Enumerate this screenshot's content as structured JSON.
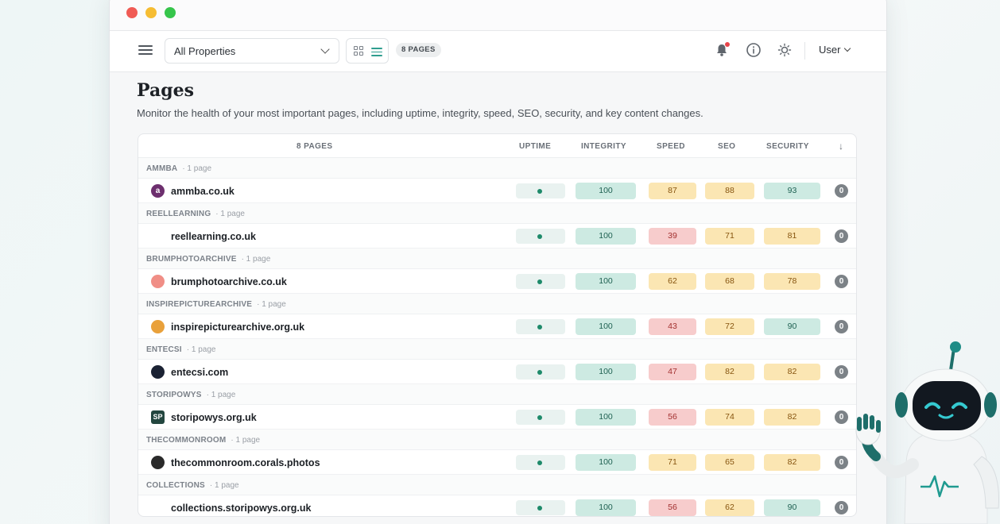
{
  "toolbar": {
    "property_select": "All Properties",
    "pages_badge": "8 PAGES",
    "user_label": "User"
  },
  "page": {
    "title": "Pages",
    "description": "Monitor the health of your most important pages, including uptime, integrity, speed, SEO, security, and key content changes."
  },
  "table": {
    "headers": {
      "pages": "8 PAGES",
      "uptime": "UPTIME",
      "integrity": "INTEGRITY",
      "speed": "SPEED",
      "seo": "SEO",
      "security": "SECURITY",
      "sort_arrow": "↓"
    },
    "groups": [
      {
        "name": "AMMBA",
        "count": "· 1 page",
        "site": "ammba.co.uk",
        "favicon_char": "a",
        "favicon_color": "#6d2f6e",
        "integrity": "100",
        "speed": "87",
        "seo": "88",
        "security": "93",
        "changes": "0",
        "status": {
          "integrity": "good",
          "speed": "warn",
          "seo": "warn",
          "security": "good"
        }
      },
      {
        "name": "REELLEARNING",
        "count": "· 1 page",
        "site": "reellearning.co.uk",
        "favicon_char": "",
        "favicon_color": "#ffffff",
        "integrity": "100",
        "speed": "39",
        "seo": "71",
        "security": "81",
        "changes": "0",
        "status": {
          "integrity": "good",
          "speed": "bad",
          "seo": "warn",
          "security": "warn"
        }
      },
      {
        "name": "BRUMPHOTOARCHIVE",
        "count": "· 1 page",
        "site": "brumphotoarchive.co.uk",
        "favicon_char": "",
        "favicon_color": "#f08e86",
        "integrity": "100",
        "speed": "62",
        "seo": "68",
        "security": "78",
        "changes": "0",
        "status": {
          "integrity": "good",
          "speed": "warn",
          "seo": "warn",
          "security": "warn"
        }
      },
      {
        "name": "INSPIREPICTUREARCHIVE",
        "count": "· 1 page",
        "site": "inspirepicturearchive.org.uk",
        "favicon_char": "",
        "favicon_color": "#e9a13b",
        "integrity": "100",
        "speed": "43",
        "seo": "72",
        "security": "90",
        "changes": "0",
        "status": {
          "integrity": "good",
          "speed": "bad",
          "seo": "warn",
          "security": "good"
        }
      },
      {
        "name": "ENTECSI",
        "count": "· 1 page",
        "site": "entecsi.com",
        "favicon_char": "",
        "favicon_color": "#1b2233",
        "integrity": "100",
        "speed": "47",
        "seo": "82",
        "security": "82",
        "changes": "0",
        "status": {
          "integrity": "good",
          "speed": "bad",
          "seo": "warn",
          "security": "warn"
        }
      },
      {
        "name": "STORIPOWYS",
        "count": "· 1 page",
        "site": "storipowys.org.uk",
        "favicon_char": "SP",
        "favicon_color": "#23463f",
        "integrity": "100",
        "speed": "56",
        "seo": "74",
        "security": "82",
        "changes": "0",
        "status": {
          "integrity": "good",
          "speed": "bad",
          "seo": "warn",
          "security": "warn"
        }
      },
      {
        "name": "THECOMMONROOM",
        "count": "· 1 page",
        "site": "thecommonroom.corals.photos",
        "favicon_char": "",
        "favicon_color": "#2a2a2a",
        "integrity": "100",
        "speed": "71",
        "seo": "65",
        "security": "82",
        "changes": "0",
        "status": {
          "integrity": "good",
          "speed": "warn",
          "seo": "warn",
          "security": "warn"
        }
      },
      {
        "name": "COLLECTIONS",
        "count": "· 1 page",
        "site": "collections.storipowys.org.uk",
        "favicon_char": "",
        "favicon_color": "#ffffff",
        "integrity": "100",
        "speed": "56",
        "seo": "62",
        "security": "90",
        "changes": "0",
        "status": {
          "integrity": "good",
          "speed": "bad",
          "seo": "warn",
          "security": "good"
        }
      }
    ]
  },
  "icons": {
    "menu": "hamburger-icon",
    "grid": "grid-view-icon",
    "list": "list-view-icon",
    "bell": "bell-icon",
    "info": "info-icon",
    "theme": "sun-icon"
  },
  "colors": {
    "good": "#cdeae2",
    "warn": "#fbe6b3",
    "bad": "#f7cccc",
    "uptime_dot": "#1e8a6a",
    "accent": "#2f9d8f"
  }
}
